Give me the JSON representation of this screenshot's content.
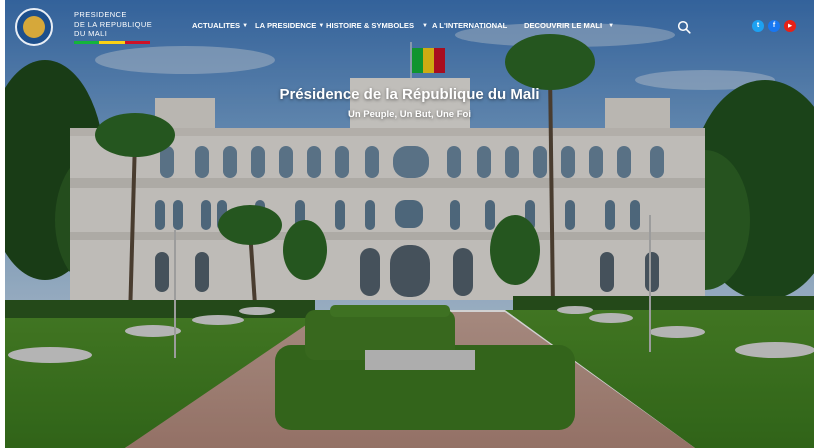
{
  "header": {
    "brand_lines": [
      "PRESIDENCE",
      "DE LA REPUBLIQUE",
      "DU MALI"
    ],
    "nav": [
      {
        "label": "ACTUALITES",
        "dropdown": true
      },
      {
        "label": "LA PRESIDENCE",
        "dropdown": true
      },
      {
        "label": "HISTOIRE & SYMBOLES",
        "dropdown": true
      },
      {
        "label": "A L'INTERNATIONAL",
        "dropdown": false
      },
      {
        "label": "DECOUVRIR LE MALI",
        "dropdown": true
      }
    ],
    "search_icon": "search-icon",
    "social": [
      {
        "name": "twitter-icon",
        "glyph": "t",
        "color": "#1da1f2"
      },
      {
        "name": "facebook-icon",
        "glyph": "f",
        "color": "#1877f2"
      },
      {
        "name": "youtube-icon",
        "glyph": "▶",
        "color": "#e62117"
      }
    ]
  },
  "hero": {
    "title": "Présidence de la République du Mali",
    "subtitle": "Un Peuple, Un But, Une Foi"
  },
  "colors": {
    "flag_green": "#14b53a",
    "flag_yellow": "#fcd116",
    "flag_red": "#ce1126"
  }
}
